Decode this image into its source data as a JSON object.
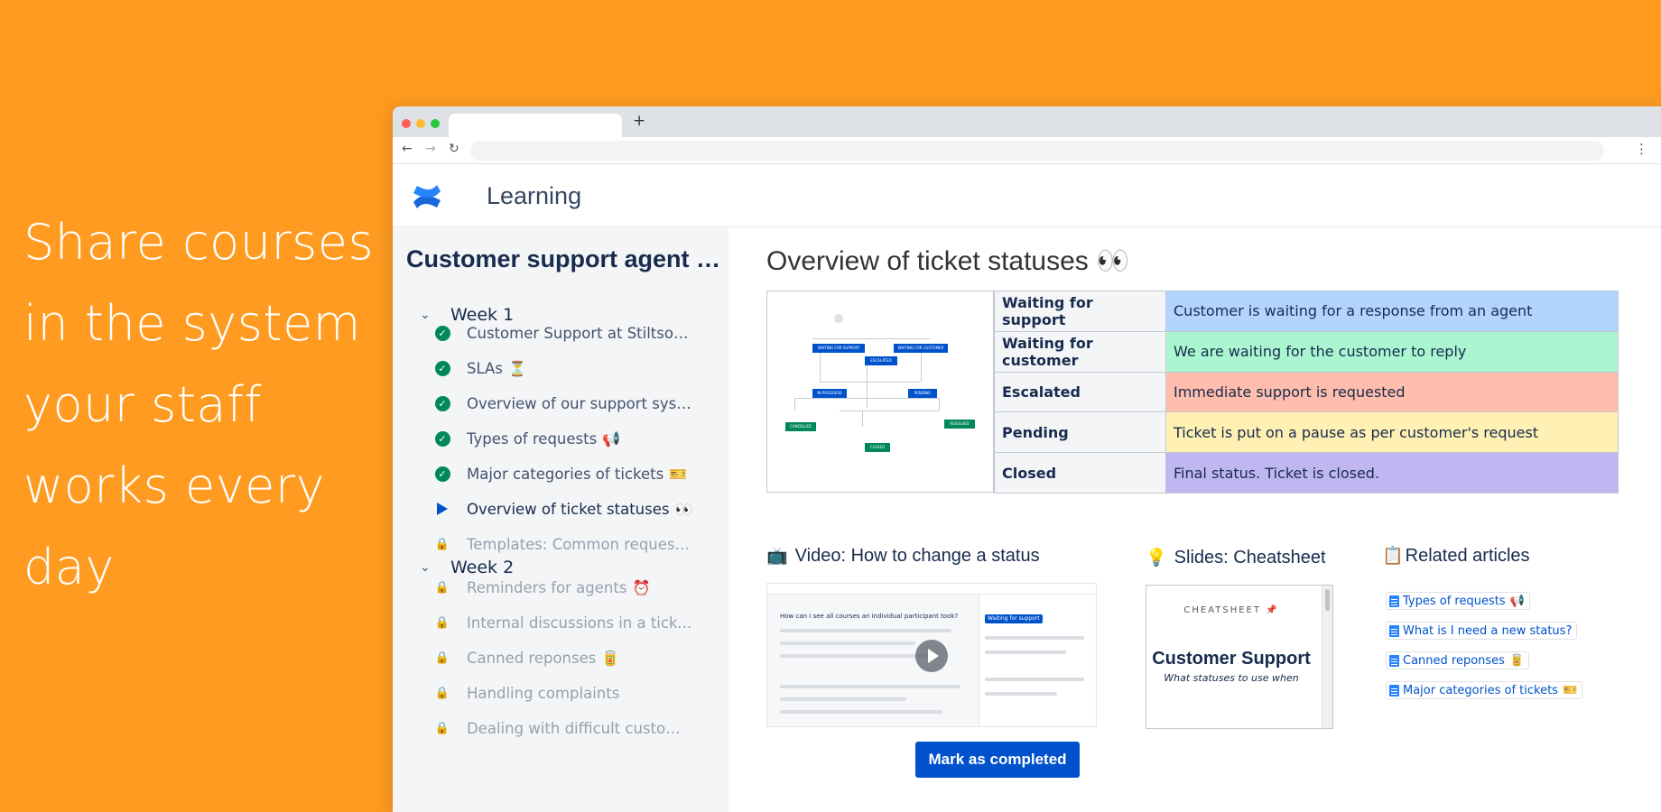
{
  "hero": {
    "lines": [
      "Share courses",
      "in the system",
      "your staff",
      "works every",
      "day"
    ]
  },
  "browser": {
    "new_tab_symbol": "+"
  },
  "app": {
    "title": "Learning"
  },
  "sidebar": {
    "course_title": "Customer support agent onboarding",
    "weeks": [
      {
        "label": "Week 1",
        "lessons": [
          {
            "label": "Customer Support at Stiltsoft overview",
            "emoji": "",
            "status": "completed"
          },
          {
            "label": "SLAs",
            "emoji": "⏳",
            "status": "completed"
          },
          {
            "label": "Overview of our support system",
            "emoji": "",
            "status": "completed"
          },
          {
            "label": "Types of requests",
            "emoji": "📢",
            "status": "completed"
          },
          {
            "label": "Major categories of tickets",
            "emoji": "🎫",
            "status": "completed"
          },
          {
            "label": "Overview of ticket statuses",
            "emoji": "👀",
            "status": "current"
          },
          {
            "label": "Templates: Common requests and responses",
            "emoji": "",
            "status": "locked"
          }
        ]
      },
      {
        "label": "Week 2",
        "lessons": [
          {
            "label": "Reminders for agents",
            "emoji": "⏰",
            "status": "locked"
          },
          {
            "label": "Internal discussions in a ticket thread",
            "emoji": "",
            "status": "locked"
          },
          {
            "label": "Canned reponses",
            "emoji": "🥫",
            "status": "locked"
          },
          {
            "label": "Handling complaints",
            "emoji": "",
            "status": "locked"
          },
          {
            "label": "Dealing with difficult customers",
            "emoji": "",
            "status": "locked"
          }
        ]
      }
    ]
  },
  "main": {
    "title": "Overview of ticket statuses 👀",
    "diagram": {
      "nodes": [
        "WAITING FOR SUPPORT",
        "WAITING FOR CUSTOMER",
        "ESCALATED",
        "IN PROGRESS",
        "PENDING",
        "CANCELLED",
        "RESOLVED",
        "CLOSED"
      ]
    },
    "statuses": [
      {
        "name": "Waiting for support",
        "desc": "Customer is waiting for a response from an agent",
        "color": "#B3D4FF"
      },
      {
        "name": "Waiting for customer",
        "desc": "We are waiting for the customer to reply",
        "color": "#ABF5D1"
      },
      {
        "name": "Escalated",
        "desc": "Immediate support is requested",
        "color": "#FFBDAD"
      },
      {
        "name": "Pending",
        "desc": "Ticket is put on a pause as per customer's request",
        "color": "#FFF0B3"
      },
      {
        "name": "Closed",
        "desc": "Final status. Ticket is closed.",
        "color": "#C0B6F2"
      }
    ],
    "video": {
      "icon": "📺",
      "title": "Video: How to change a status",
      "thumb_question": "How can I see all courses an individual participant took?",
      "thumb_status": "Waiting for support"
    },
    "slides": {
      "icon": "💡",
      "title": "Slides: Cheatsheet",
      "small_text": "CHEATSHEET 📌",
      "big_text": "Customer Support",
      "sub_text": "What statuses to use when"
    },
    "articles": {
      "icon": "📋",
      "title": "Related articles",
      "items": [
        {
          "label": "Types of requests",
          "emoji": "📢"
        },
        {
          "label": "What is I need a new status?",
          "emoji": ""
        },
        {
          "label": "Canned reponses",
          "emoji": "🥫"
        },
        {
          "label": "Major categories of tickets",
          "emoji": "🎫"
        }
      ]
    },
    "mark_button": "Mark as completed"
  },
  "colors": {
    "background": "#FF9B20",
    "accent": "#0052CC",
    "completed": "#00875A"
  }
}
